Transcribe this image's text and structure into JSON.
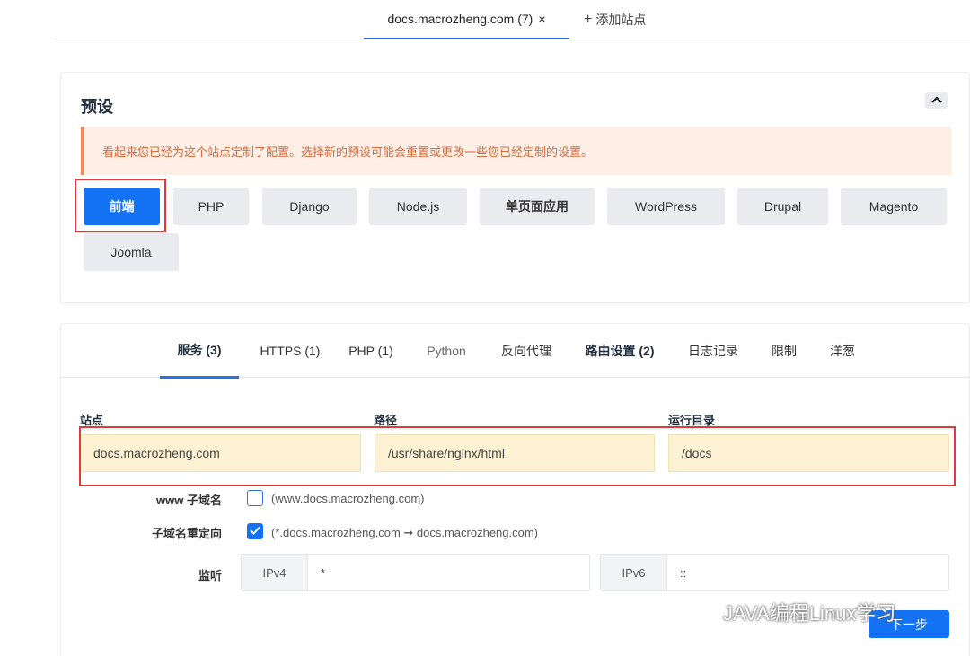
{
  "top_tabs": {
    "site_tab": "docs.macrozheng.com (7)",
    "close_glyph": "×",
    "add_site": "添加站点"
  },
  "preset": {
    "title": "预设",
    "notice": "看起来您已经为这个站点定制了配置。选择新的预设可能会重置或更改一些您已经定制的设置。",
    "buttons": [
      "前端",
      "PHP",
      "Django",
      "Node.js",
      "单页面应用",
      "WordPress",
      "Drupal",
      "Magento",
      "Joomla"
    ],
    "active": "前端"
  },
  "settings": {
    "tabs": [
      "服务 (3)",
      "HTTPS (1)",
      "PHP (1)",
      "Python",
      "反向代理",
      "路由设置 (2)",
      "日志记录",
      "限制",
      "洋葱"
    ],
    "active_tab": "服务 (3)",
    "fields": {
      "site_label": "站点",
      "site_value": "docs.macrozheng.com",
      "path_label": "路径",
      "path_value": "/usr/share/nginx/html",
      "root_label": "运行目录",
      "root_value": "/docs"
    },
    "www": {
      "label": "www 子域名",
      "hint": "(www.docs.macrozheng.com)",
      "checked": false
    },
    "redirect": {
      "label": "子域名重定向",
      "hint": "(*.docs.macrozheng.com ➞ docs.macrozheng.com)",
      "checked": true
    },
    "listen": {
      "label": "监听",
      "ipv4_prefix": "IPv4",
      "ipv4_value": "*",
      "ipv6_prefix": "IPv6",
      "ipv6_value": "::"
    },
    "next_button": "下一步"
  },
  "watermark": "JAVA编程Linux学习",
  "colors": {
    "accent": "#1473f5",
    "notice_bg": "#fdeee6",
    "notice_text": "#d46b3c",
    "field_bg": "#fcf1d2",
    "highlight": "#e03a3a"
  }
}
